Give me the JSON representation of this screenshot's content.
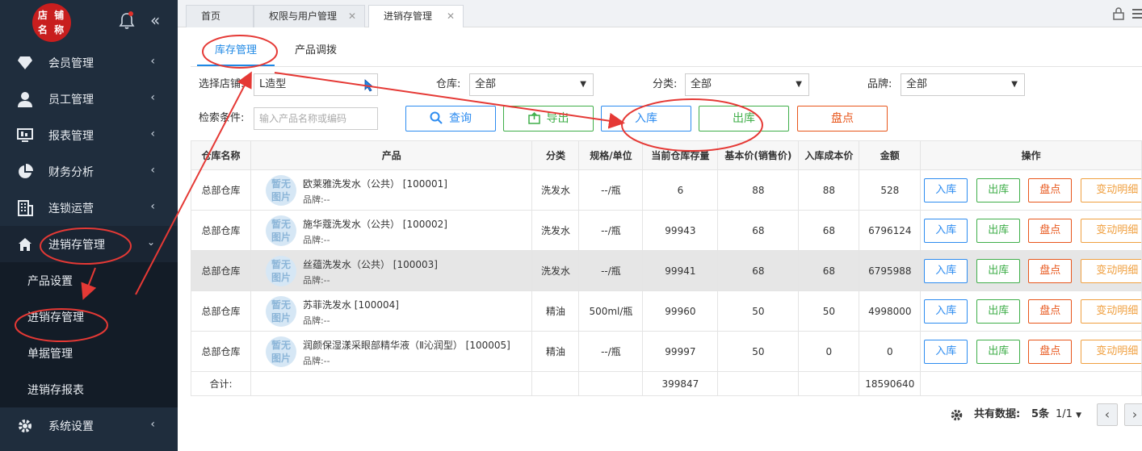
{
  "sidebar": {
    "logo_text": "店铺名称",
    "logo_line1": "店 铺",
    "logo_line2": "名 称",
    "items": [
      {
        "label": "会员管理",
        "icon": "diamond-icon"
      },
      {
        "label": "员工管理",
        "icon": "user-icon"
      },
      {
        "label": "报表管理",
        "icon": "monitor-icon"
      },
      {
        "label": "财务分析",
        "icon": "pie-chart-icon"
      },
      {
        "label": "连锁运营",
        "icon": "building-icon"
      },
      {
        "label": "进销存管理",
        "icon": "home-icon"
      }
    ],
    "sub_items": [
      "产品设置",
      "进销存管理",
      "单据管理",
      "进销存报表"
    ],
    "bottom_item": {
      "label": "系统设置",
      "icon": "gear-icon"
    }
  },
  "tabs": [
    {
      "label": "首页"
    },
    {
      "label": "权限与用户管理"
    },
    {
      "label": "进销存管理"
    }
  ],
  "subtabs": [
    "库存管理",
    "产品调拨"
  ],
  "filters": {
    "store_label": "选择店铺:",
    "store_value": "L造型",
    "warehouse_label": "仓库:",
    "warehouse_value": "全部",
    "category_label": "分类:",
    "category_value": "全部",
    "brand_label": "品牌:",
    "brand_value": "全部",
    "search_label": "检索条件:",
    "search_placeholder": "输入产品名称或编码"
  },
  "buttons": {
    "query": "查询",
    "export": "导出",
    "stock_in": "入库",
    "stock_out": "出库",
    "inventory": "盘点"
  },
  "table": {
    "headers": [
      "仓库名称",
      "产品",
      "分类",
      "规格/单位",
      "当前仓库存量",
      "基本价(销售价)",
      "入库成本价",
      "金额",
      "操作"
    ],
    "no_image": "暂无图片",
    "no_image_l1": "暂无",
    "no_image_l2": "图片",
    "rows": [
      {
        "warehouse": "总部仓库",
        "name": "欧莱雅洗发水（公共） [100001]",
        "brand": "品牌:--",
        "category": "洗发水",
        "spec": "--/瓶",
        "stock": "6",
        "price": "88",
        "cost": "88",
        "amount": "528"
      },
      {
        "warehouse": "总部仓库",
        "name": "施华蔻洗发水（公共） [100002]",
        "brand": "品牌:--",
        "category": "洗发水",
        "spec": "--/瓶",
        "stock": "99943",
        "price": "68",
        "cost": "68",
        "amount": "6796124"
      },
      {
        "warehouse": "总部仓库",
        "name": "丝蕴洗发水（公共） [100003]",
        "brand": "品牌:--",
        "category": "洗发水",
        "spec": "--/瓶",
        "stock": "99941",
        "price": "68",
        "cost": "68",
        "amount": "6795988"
      },
      {
        "warehouse": "总部仓库",
        "name": "苏菲洗发水 [100004]",
        "brand": "品牌:--",
        "category": "精油",
        "spec": "500ml/瓶",
        "stock": "99960",
        "price": "50",
        "cost": "50",
        "amount": "4998000"
      },
      {
        "warehouse": "总部仓库",
        "name": "润颜保湿漾采眼部精华液（Ⅱ沁润型） [100005]",
        "brand": "品牌:--",
        "category": "精油",
        "spec": "--/瓶",
        "stock": "99997",
        "price": "50",
        "cost": "0",
        "amount": "0"
      }
    ],
    "row_buttons": [
      "入库",
      "出库",
      "盘点",
      "变动明细"
    ],
    "summary": {
      "label": "合计:",
      "stock": "399847",
      "amount": "18590640"
    }
  },
  "pager": {
    "total_label": "共有数据:",
    "total_value": "5条",
    "page": "1/1"
  },
  "colors": {
    "sidebar_bg": "#1f2d3d",
    "accent_blue": "#2d8cf0",
    "green": "#3fae49",
    "red": "#e8561b",
    "orange": "#f0a040",
    "annotation_red": "#e53935"
  }
}
